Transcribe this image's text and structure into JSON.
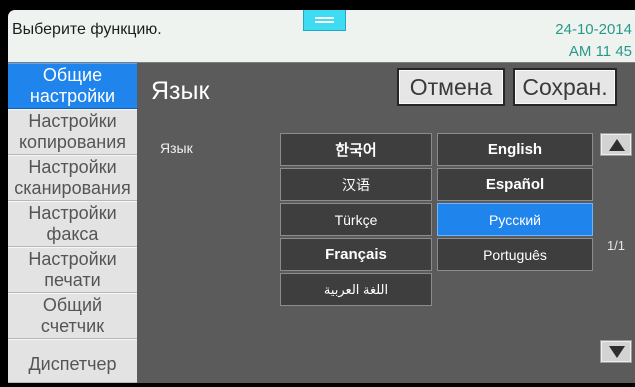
{
  "status_bar": {
    "message": "Выберите функцию.",
    "handle_icon": "handle-icon",
    "date": "24-10-2014",
    "time": "AM 11 45"
  },
  "sidebar": {
    "items": [
      {
        "lines": [
          "Общие",
          "настройки"
        ],
        "selected": true
      },
      {
        "lines": [
          "Настройки",
          "копирования"
        ],
        "selected": false
      },
      {
        "lines": [
          "Настройки",
          "сканирования"
        ],
        "selected": false
      },
      {
        "lines": [
          "Настройки",
          "факса"
        ],
        "selected": false
      },
      {
        "lines": [
          "Настройки",
          "печати"
        ],
        "selected": false
      },
      {
        "lines": [
          "Общий",
          "счетчик"
        ],
        "selected": false
      },
      {
        "lines": [
          "Диспетчер"
        ],
        "selected": false
      }
    ]
  },
  "header": {
    "title": "Язык",
    "cancel_label": "Отмена",
    "save_label": "Сохран."
  },
  "language_setting": {
    "label": "Язык",
    "options": [
      {
        "label": "한국어",
        "selected": false
      },
      {
        "label": "English",
        "selected": false
      },
      {
        "label": "汉语",
        "selected": false
      },
      {
        "label": "Español",
        "selected": false
      },
      {
        "label": "Türkçe",
        "selected": false
      },
      {
        "label": "Русский",
        "selected": true
      },
      {
        "label": "Français",
        "selected": false
      },
      {
        "label": "Português",
        "selected": false
      },
      {
        "label": "اللغة العربية",
        "selected": false
      }
    ],
    "page_indicator": "1/1",
    "scroll_up_icon": "triangle-up-icon",
    "scroll_down_icon": "triangle-down-icon"
  },
  "colors": {
    "accent": "#1f84ec",
    "status_time": "#27998a",
    "handle": "#3ddcf2",
    "panel": "#5b5b5b",
    "sidebar": "#e3e3e3"
  }
}
